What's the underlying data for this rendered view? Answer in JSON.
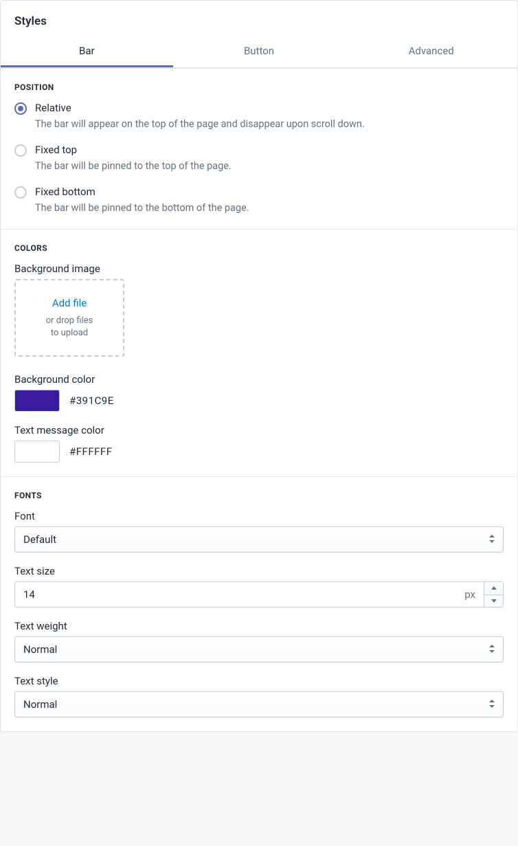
{
  "header": {
    "title": "Styles"
  },
  "tabs": {
    "bar": "Bar",
    "button": "Button",
    "advanced": "Advanced",
    "active": "bar"
  },
  "position": {
    "section_title": "POSITION",
    "options": [
      {
        "label": "Relative",
        "description": "The bar will appear on the top of the page and disappear upon scroll down.",
        "checked": true
      },
      {
        "label": "Fixed top",
        "description": "The bar will be pinned to the top of the page.",
        "checked": false
      },
      {
        "label": "Fixed bottom",
        "description": "The bar will be pinned to the bottom of the page.",
        "checked": false
      }
    ]
  },
  "colors": {
    "section_title": "COLORS",
    "bg_image_label": "Background image",
    "dropzone": {
      "add_file": "Add file",
      "hint_line1": "or drop files",
      "hint_line2": "to upload"
    },
    "bg_color": {
      "label": "Background color",
      "value": "#391C9E"
    },
    "text_color": {
      "label": "Text message color",
      "value": "#FFFFFF"
    }
  },
  "fonts": {
    "section_title": "FONTS",
    "font": {
      "label": "Font",
      "value": "Default"
    },
    "text_size": {
      "label": "Text size",
      "value": "14",
      "unit": "px"
    },
    "text_weight": {
      "label": "Text weight",
      "value": "Normal"
    },
    "text_style": {
      "label": "Text style",
      "value": "Normal"
    }
  }
}
